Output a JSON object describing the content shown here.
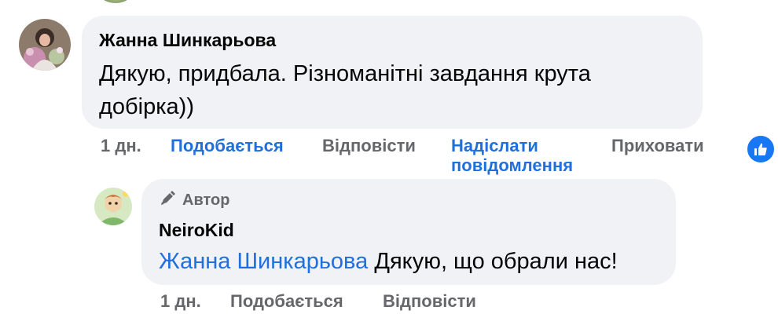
{
  "comment": {
    "author": "Жанна Шинкарьова",
    "text": "Дякую, придбала. Різноманітні завдання крута добірка))",
    "time": "1 дн.",
    "actions": {
      "like": "Подобається",
      "reply": "Відповісти",
      "send_message": "Надіслати повідомлення",
      "hide": "Приховати"
    },
    "reaction_icon": "thumbs-up-icon"
  },
  "reply": {
    "badge": "Автор",
    "badge_icon": "pen-icon",
    "author": "NeiroKid",
    "mention": "Жанна Шинкарьова",
    "text": " Дякую, що обрали нас!",
    "time": "1 дн.",
    "actions": {
      "like": "Подобається",
      "reply": "Відповісти"
    }
  },
  "colors": {
    "bubble": "#f0f2f5",
    "link_blue": "#216fdb",
    "muted": "#65676b",
    "reaction_blue": "#1877f2"
  }
}
